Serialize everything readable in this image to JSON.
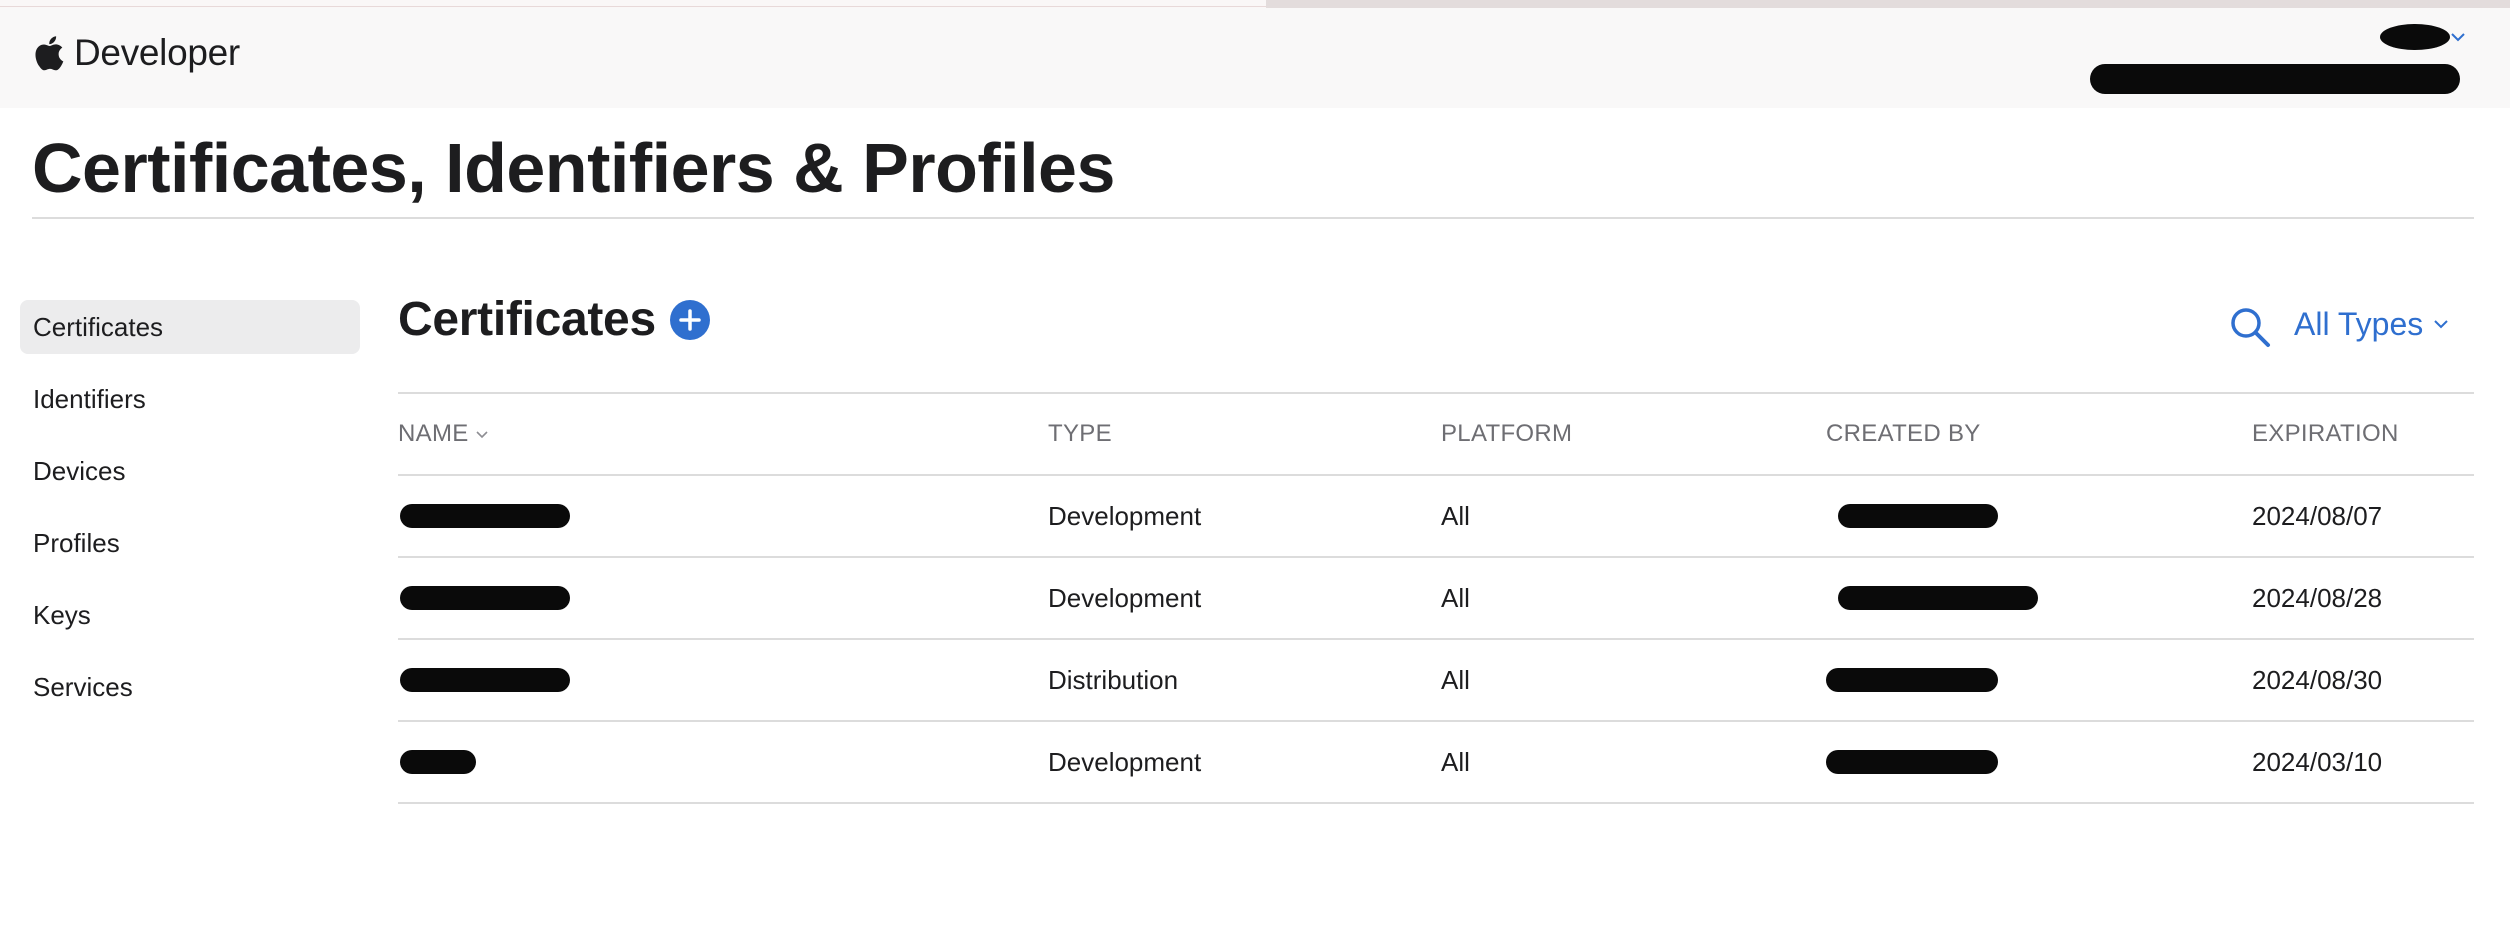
{
  "header": {
    "brand_text": "Developer"
  },
  "page_title": "Certificates, Identifiers & Profiles",
  "sidebar": {
    "items": [
      {
        "label": "Certificates",
        "active": true
      },
      {
        "label": "Identifiers",
        "active": false
      },
      {
        "label": "Devices",
        "active": false
      },
      {
        "label": "Profiles",
        "active": false
      },
      {
        "label": "Keys",
        "active": false
      },
      {
        "label": "Services",
        "active": false
      }
    ]
  },
  "main": {
    "heading": "Certificates",
    "filter_label": "All Types"
  },
  "table": {
    "columns": [
      "NAME",
      "TYPE",
      "PLATFORM",
      "CREATED BY",
      "EXPIRATION"
    ],
    "rows": [
      {
        "type": "Development",
        "platform": "All",
        "expiration": "2024/08/07"
      },
      {
        "type": "Development",
        "platform": "All",
        "expiration": "2024/08/28"
      },
      {
        "type": "Distribution",
        "platform": "All",
        "expiration": "2024/08/30"
      },
      {
        "type": "Development",
        "platform": "All",
        "expiration": "2024/03/10"
      }
    ]
  },
  "colors": {
    "accent": "#2f6fcf",
    "text": "#1d1d1f",
    "muted": "#6e6e73",
    "sidebar_active_bg": "#ececed"
  },
  "icons": {
    "brand": "apple-icon",
    "add": "plus-circle-icon",
    "search": "search-icon",
    "filter": "chevron-down-icon",
    "sort": "chevron-down-icon",
    "account": "chevron-down-icon"
  }
}
